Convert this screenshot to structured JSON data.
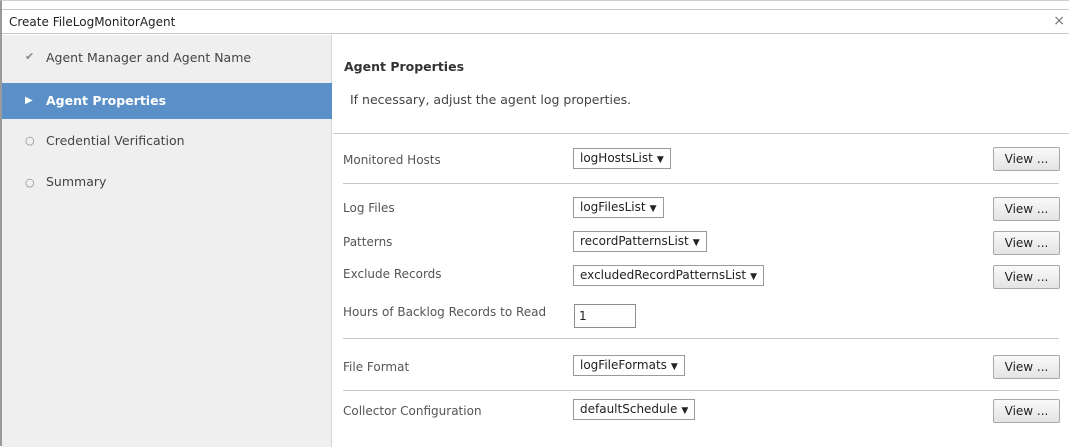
{
  "window": {
    "title": "Create FileLogMonitorAgent",
    "close_glyph": "×"
  },
  "steps": [
    {
      "label": "Agent Manager and Agent Name",
      "mark": "✔",
      "state": "completed"
    },
    {
      "label": "Agent Properties",
      "mark": "▶",
      "state": "active"
    },
    {
      "label": "Credential Verification",
      "mark": "○",
      "state": "pending"
    },
    {
      "label": "Summary",
      "mark": "○",
      "state": "pending"
    }
  ],
  "main": {
    "heading": "Agent Properties",
    "subtext": "If necessary, adjust the agent log properties."
  },
  "properties": {
    "monitored_hosts": {
      "label": "Monitored Hosts",
      "value": "logHostsList",
      "view": "View ..."
    },
    "log_files": {
      "label": "Log Files",
      "value": "logFilesList",
      "view": "View ..."
    },
    "patterns": {
      "label": "Patterns",
      "value": "recordPatternsList",
      "view": "View ..."
    },
    "exclude_records": {
      "label": "Exclude Records",
      "value": "excludedRecordPatternsList",
      "view": "View ..."
    },
    "backlog_hours": {
      "label": "Hours of Backlog Records to Read",
      "value": "1"
    },
    "file_format": {
      "label": "File Format",
      "value": "logFileFormats",
      "view": "View ..."
    },
    "collector_configuration": {
      "label": "Collector Configuration",
      "value": "defaultSchedule",
      "view": "View ..."
    }
  },
  "colors": {
    "active_step_bg": "#5b8fc7",
    "sidebar_bg": "#efefef"
  }
}
